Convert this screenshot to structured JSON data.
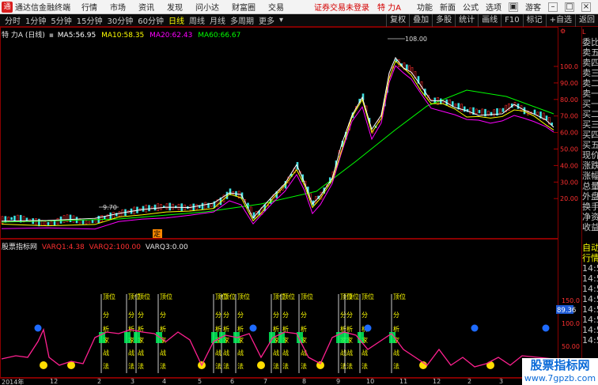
{
  "topbar": {
    "app_name": "通达信金融终端",
    "menus": [
      "行情",
      "市场",
      "资讯",
      "发现",
      "问小达",
      "财富圈",
      "交易"
    ],
    "notice": "证券交易未登录",
    "stock": "特 力A",
    "right_items": [
      "功能",
      "新面",
      "公式",
      "选项"
    ],
    "guest": "游客"
  },
  "toolbar": {
    "periods": [
      "分时",
      "1分钟",
      "5分钟",
      "15分钟",
      "30分钟",
      "60分钟",
      "日线",
      "周线",
      "月线",
      "多周期",
      "更多"
    ],
    "active_period": "日线",
    "tools": [
      "复权",
      "叠加",
      "多股",
      "统计",
      "画线",
      "F10",
      "标记",
      "+自选",
      "返回"
    ]
  },
  "main_header": {
    "title": "特 力A (日线)",
    "ma5_label": "MA5:",
    "ma5": "56.95",
    "ma10_label": "MA10:",
    "ma10": "58.35",
    "ma20_label": "MA20:",
    "ma20": "62.43",
    "ma60_label": "MA60:",
    "ma60": "66.67",
    "colors": {
      "ma5": "#ffffff",
      "ma10": "#ffff00",
      "ma20": "#ff00ff",
      "ma60": "#00ff00"
    }
  },
  "indicator_header": {
    "name": "股票指标网",
    "varq1_label": "VARQ1:",
    "varq1": "4.38",
    "varq2_label": "VARQ2:",
    "varq2": "100.00",
    "varq3_label": "VARQ3:",
    "varq3": "0.00"
  },
  "price_axis": {
    "ticks": [
      "100.0",
      "90.00",
      "80.00",
      "70.00",
      "60.00",
      "50.00",
      "40.00",
      "30.00",
      "20.00"
    ],
    "tick_values": [
      100,
      90,
      80,
      70,
      60,
      50,
      40,
      30,
      20
    ],
    "high_label": "108.00",
    "low_label": "9.70",
    "marker": "定"
  },
  "sub_axis": {
    "ticks": [
      "150.0",
      "100.0",
      "50.00"
    ],
    "tick_values": [
      150,
      100,
      50
    ],
    "current": "89.36"
  },
  "signal_labels": [
    "顶位",
    "分",
    "析",
    "家",
    "战",
    "法"
  ],
  "x_axis": {
    "labels": [
      "2014年",
      "12",
      "2",
      "3",
      "4",
      "5",
      "6",
      "7",
      "8",
      "9",
      "10",
      "11",
      "12",
      "2",
      "3",
      "4",
      "5"
    ]
  },
  "quote_panel": {
    "title": "L",
    "items": [
      "委比",
      "卖五",
      "卖四",
      "卖三",
      "卖二",
      "卖一",
      "买一",
      "买二",
      "买三",
      "买四",
      "买五",
      "现价",
      "涨跌",
      "涨幅",
      "总量",
      "外盘",
      "换手",
      "净资",
      "收益",
      "",
      "自动",
      "行情",
      "14:5",
      "14:5",
      "14:5",
      "14:5",
      "14:5",
      "14:5",
      "14:5",
      "14:5"
    ]
  },
  "watermark": {
    "line1": "股票指标网",
    "line2": "www.7gpzb.com"
  }
}
